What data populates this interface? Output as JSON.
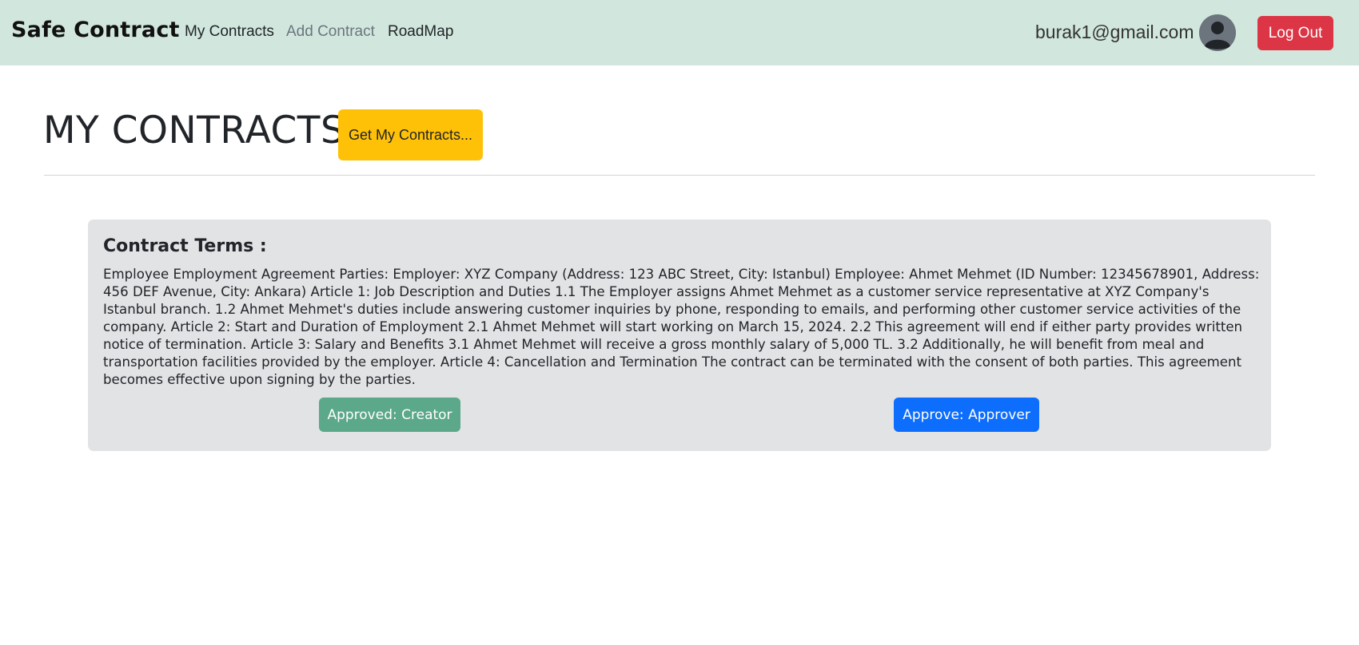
{
  "navbar": {
    "brand": "Safe Contract",
    "links": [
      {
        "label": "My Contracts"
      },
      {
        "label": "Add Contract"
      },
      {
        "label": "RoadMap"
      }
    ],
    "user_email": "burak1@gmail.com",
    "avatar_icon": "user-avatar-icon",
    "logout_label": "Log Out"
  },
  "header": {
    "title": "MY CONTRACTS",
    "get_button_label": "Get My Contracts..."
  },
  "contract": {
    "title": "Contract Terms :",
    "text": "Employee Employment Agreement Parties: Employer: XYZ Company (Address: 123 ABC Street, City: Istanbul) Employee: Ahmet Mehmet (ID Number: 12345678901, Address: 456 DEF Avenue, City: Ankara) Article 1: Job Description and Duties 1.1 The Employer assigns Ahmet Mehmet as a customer service representative at XYZ Company's Istanbul branch. 1.2 Ahmet Mehmet's duties include answering customer inquiries by phone, responding to emails, and performing other customer service activities of the company. Article 2: Start and Duration of Employment 2.1 Ahmet Mehmet will start working on March 15, 2024. 2.2 This agreement will end if either party provides written notice of termination. Article 3: Salary and Benefits 3.1 Ahmet Mehmet will receive a gross monthly salary of 5,000 TL. 3.2 Additionally, he will benefit from meal and transportation facilities provided by the employer. Article 4: Cancellation and Termination The contract can be terminated with the consent of both parties. This agreement becomes effective upon signing by the parties.",
    "approved_creator_label": "Approved: Creator",
    "approve_approver_label": "Approve: Approver"
  },
  "colors": {
    "navbar_bg": "#d1e7dd",
    "logout": "#dc3545",
    "get_button": "#ffc107",
    "card_bg": "#e2e3e5",
    "approved": "#5ba88a",
    "approve": "#0d6efd"
  }
}
